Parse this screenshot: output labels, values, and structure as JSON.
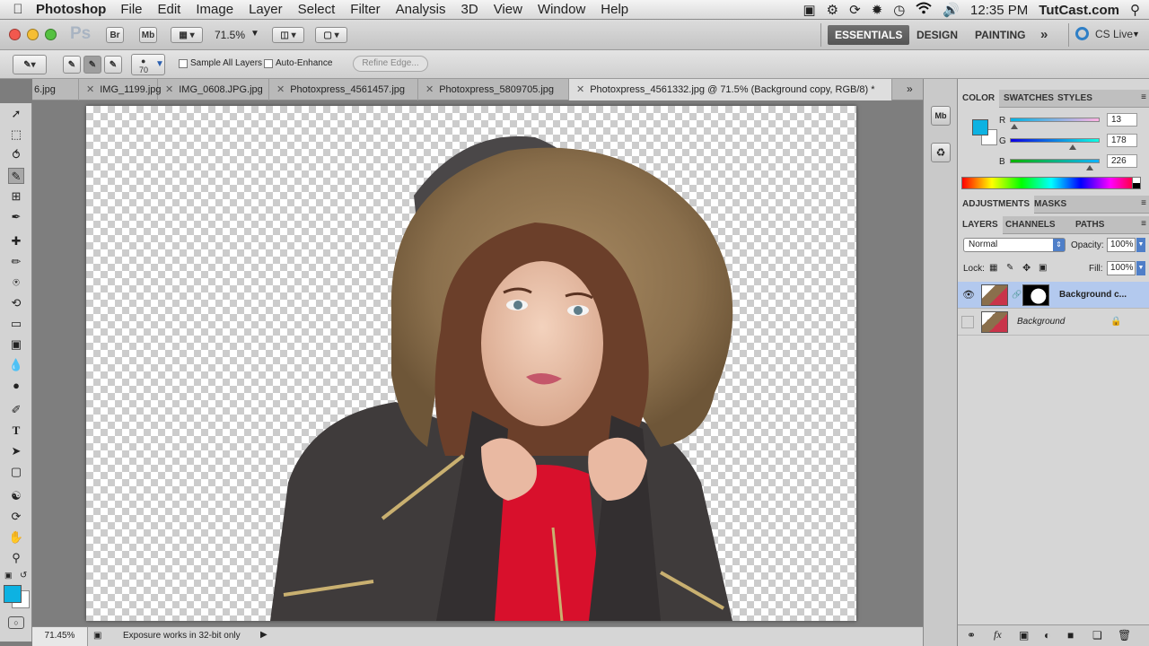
{
  "menubar": {
    "app_name": "Photoshop",
    "menus": [
      "File",
      "Edit",
      "Image",
      "Layer",
      "Select",
      "Filter",
      "Analysis",
      "3D",
      "View",
      "Window",
      "Help"
    ],
    "clock": "12:35 PM",
    "site": "TutCast.com"
  },
  "appbar": {
    "ps_logo": "Ps",
    "bridge_label": "Br",
    "minibridge_label": "Mb",
    "zoom_value": "71.5%",
    "workspaces": [
      "ESSENTIALS",
      "DESIGN",
      "PAINTING"
    ],
    "more_label": "»",
    "cs_live_label": "CS Live"
  },
  "options": {
    "brush_size": "70",
    "sample_all_layers": "Sample All Layers",
    "auto_enhance": "Auto-Enhance",
    "refine_edge": "Refine Edge..."
  },
  "tabs": [
    {
      "label": "6.jpg",
      "active": false
    },
    {
      "label": "IMG_1199.jpg",
      "active": false
    },
    {
      "label": "IMG_0608.JPG.jpg",
      "active": false
    },
    {
      "label": "Photoxpress_4561457.jpg",
      "active": false
    },
    {
      "label": "Photoxpress_5809705.jpg",
      "active": false
    },
    {
      "label": "Photoxpress_4561332.jpg @ 71.5% (Background copy, RGB/8) *",
      "active": true
    }
  ],
  "status": {
    "zoom": "71.45%",
    "info": "Exposure works in 32-bit only"
  },
  "color_panel": {
    "tabs": [
      "COLOR",
      "SWATCHES",
      "STYLES"
    ],
    "channels": [
      {
        "label": "R",
        "value": "13",
        "fraction": 0.051
      },
      {
        "label": "G",
        "value": "178",
        "fraction": 0.698
      },
      {
        "label": "B",
        "value": "226",
        "fraction": 0.886
      }
    ],
    "foreground": "#0db2e2"
  },
  "adjustments_panel": {
    "tabs": [
      "ADJUSTMENTS",
      "MASKS"
    ]
  },
  "layers_panel": {
    "tabs": [
      "LAYERS",
      "CHANNELS",
      "PATHS"
    ],
    "blend_mode": "Normal",
    "opacity_label": "Opacity:",
    "opacity_value": "100%",
    "lock_label": "Lock:",
    "fill_label": "Fill:",
    "fill_value": "100%",
    "layers": [
      {
        "name": "Background c...",
        "selected": true,
        "visible": true
      },
      {
        "name": "Background",
        "selected": false,
        "visible": false
      }
    ]
  }
}
